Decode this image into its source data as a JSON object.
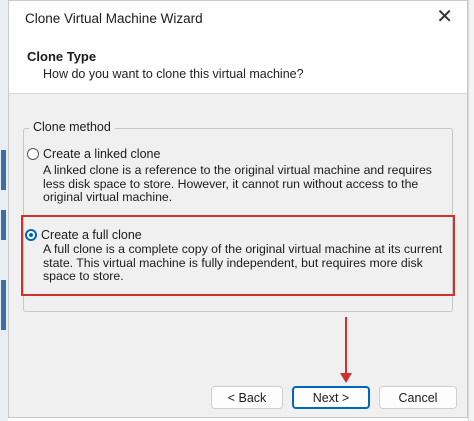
{
  "window": {
    "title": "Clone Virtual Machine Wizard",
    "close_glyph": "✕"
  },
  "header": {
    "title": "Clone Type",
    "subtitle": "How do you want to clone this virtual machine?"
  },
  "clone_method": {
    "label": "Clone method",
    "options": [
      {
        "label": "Create a linked clone",
        "description": "A linked clone is a reference to the original virtual machine and requires less disk space to store. However, it cannot run without access to the original virtual machine.",
        "selected": false
      },
      {
        "label": "Create a full clone",
        "description": "A full clone is a complete copy of the original virtual machine at its current state. This virtual machine is fully independent, but requires more disk space to store.",
        "selected": true
      }
    ]
  },
  "buttons": {
    "back": "< Back",
    "next": "Next >",
    "cancel": "Cancel"
  },
  "colors": {
    "accent": "#0067c0",
    "annotation": "#d0312d"
  }
}
